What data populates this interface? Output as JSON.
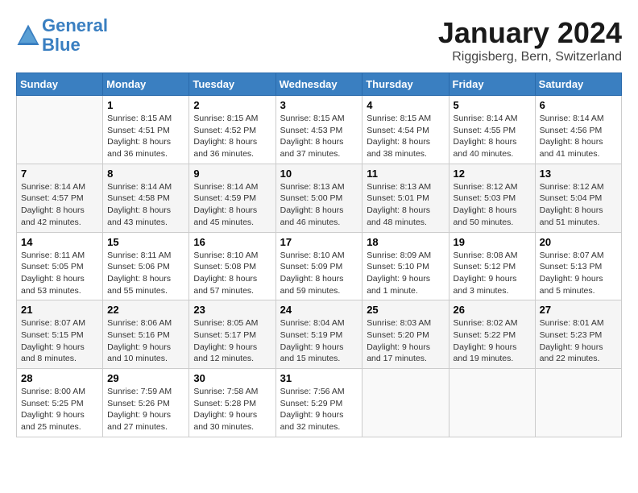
{
  "header": {
    "logo_line1": "General",
    "logo_line2": "Blue",
    "month": "January 2024",
    "location": "Riggisberg, Bern, Switzerland"
  },
  "weekdays": [
    "Sunday",
    "Monday",
    "Tuesday",
    "Wednesday",
    "Thursday",
    "Friday",
    "Saturday"
  ],
  "weeks": [
    [
      {
        "day": "",
        "info": ""
      },
      {
        "day": "1",
        "info": "Sunrise: 8:15 AM\nSunset: 4:51 PM\nDaylight: 8 hours\nand 36 minutes."
      },
      {
        "day": "2",
        "info": "Sunrise: 8:15 AM\nSunset: 4:52 PM\nDaylight: 8 hours\nand 36 minutes."
      },
      {
        "day": "3",
        "info": "Sunrise: 8:15 AM\nSunset: 4:53 PM\nDaylight: 8 hours\nand 37 minutes."
      },
      {
        "day": "4",
        "info": "Sunrise: 8:15 AM\nSunset: 4:54 PM\nDaylight: 8 hours\nand 38 minutes."
      },
      {
        "day": "5",
        "info": "Sunrise: 8:14 AM\nSunset: 4:55 PM\nDaylight: 8 hours\nand 40 minutes."
      },
      {
        "day": "6",
        "info": "Sunrise: 8:14 AM\nSunset: 4:56 PM\nDaylight: 8 hours\nand 41 minutes."
      }
    ],
    [
      {
        "day": "7",
        "info": "Sunrise: 8:14 AM\nSunset: 4:57 PM\nDaylight: 8 hours\nand 42 minutes."
      },
      {
        "day": "8",
        "info": "Sunrise: 8:14 AM\nSunset: 4:58 PM\nDaylight: 8 hours\nand 43 minutes."
      },
      {
        "day": "9",
        "info": "Sunrise: 8:14 AM\nSunset: 4:59 PM\nDaylight: 8 hours\nand 45 minutes."
      },
      {
        "day": "10",
        "info": "Sunrise: 8:13 AM\nSunset: 5:00 PM\nDaylight: 8 hours\nand 46 minutes."
      },
      {
        "day": "11",
        "info": "Sunrise: 8:13 AM\nSunset: 5:01 PM\nDaylight: 8 hours\nand 48 minutes."
      },
      {
        "day": "12",
        "info": "Sunrise: 8:12 AM\nSunset: 5:03 PM\nDaylight: 8 hours\nand 50 minutes."
      },
      {
        "day": "13",
        "info": "Sunrise: 8:12 AM\nSunset: 5:04 PM\nDaylight: 8 hours\nand 51 minutes."
      }
    ],
    [
      {
        "day": "14",
        "info": "Sunrise: 8:11 AM\nSunset: 5:05 PM\nDaylight: 8 hours\nand 53 minutes."
      },
      {
        "day": "15",
        "info": "Sunrise: 8:11 AM\nSunset: 5:06 PM\nDaylight: 8 hours\nand 55 minutes."
      },
      {
        "day": "16",
        "info": "Sunrise: 8:10 AM\nSunset: 5:08 PM\nDaylight: 8 hours\nand 57 minutes."
      },
      {
        "day": "17",
        "info": "Sunrise: 8:10 AM\nSunset: 5:09 PM\nDaylight: 8 hours\nand 59 minutes."
      },
      {
        "day": "18",
        "info": "Sunrise: 8:09 AM\nSunset: 5:10 PM\nDaylight: 9 hours\nand 1 minute."
      },
      {
        "day": "19",
        "info": "Sunrise: 8:08 AM\nSunset: 5:12 PM\nDaylight: 9 hours\nand 3 minutes."
      },
      {
        "day": "20",
        "info": "Sunrise: 8:07 AM\nSunset: 5:13 PM\nDaylight: 9 hours\nand 5 minutes."
      }
    ],
    [
      {
        "day": "21",
        "info": "Sunrise: 8:07 AM\nSunset: 5:15 PM\nDaylight: 9 hours\nand 8 minutes."
      },
      {
        "day": "22",
        "info": "Sunrise: 8:06 AM\nSunset: 5:16 PM\nDaylight: 9 hours\nand 10 minutes."
      },
      {
        "day": "23",
        "info": "Sunrise: 8:05 AM\nSunset: 5:17 PM\nDaylight: 9 hours\nand 12 minutes."
      },
      {
        "day": "24",
        "info": "Sunrise: 8:04 AM\nSunset: 5:19 PM\nDaylight: 9 hours\nand 15 minutes."
      },
      {
        "day": "25",
        "info": "Sunrise: 8:03 AM\nSunset: 5:20 PM\nDaylight: 9 hours\nand 17 minutes."
      },
      {
        "day": "26",
        "info": "Sunrise: 8:02 AM\nSunset: 5:22 PM\nDaylight: 9 hours\nand 19 minutes."
      },
      {
        "day": "27",
        "info": "Sunrise: 8:01 AM\nSunset: 5:23 PM\nDaylight: 9 hours\nand 22 minutes."
      }
    ],
    [
      {
        "day": "28",
        "info": "Sunrise: 8:00 AM\nSunset: 5:25 PM\nDaylight: 9 hours\nand 25 minutes."
      },
      {
        "day": "29",
        "info": "Sunrise: 7:59 AM\nSunset: 5:26 PM\nDaylight: 9 hours\nand 27 minutes."
      },
      {
        "day": "30",
        "info": "Sunrise: 7:58 AM\nSunset: 5:28 PM\nDaylight: 9 hours\nand 30 minutes."
      },
      {
        "day": "31",
        "info": "Sunrise: 7:56 AM\nSunset: 5:29 PM\nDaylight: 9 hours\nand 32 minutes."
      },
      {
        "day": "",
        "info": ""
      },
      {
        "day": "",
        "info": ""
      },
      {
        "day": "",
        "info": ""
      }
    ]
  ]
}
